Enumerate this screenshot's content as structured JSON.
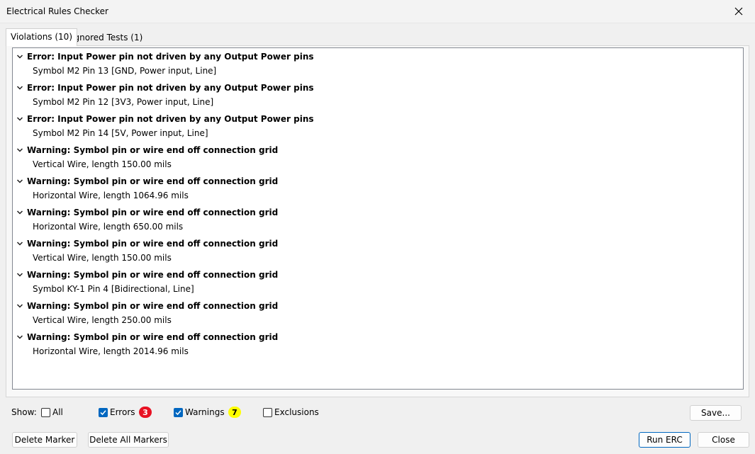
{
  "window": {
    "title": "Electrical Rules Checker"
  },
  "tabs": [
    {
      "label": "Violations (10)"
    },
    {
      "label": "Ignored Tests (1)"
    }
  ],
  "violations": [
    {
      "title": "Error: Input Power pin not driven by any Output Power pins",
      "detail": "Symbol M2 Pin 13 [GND, Power input, Line]"
    },
    {
      "title": "Error: Input Power pin not driven by any Output Power pins",
      "detail": "Symbol M2 Pin 12 [3V3, Power input, Line]"
    },
    {
      "title": "Error: Input Power pin not driven by any Output Power pins",
      "detail": "Symbol M2 Pin 14 [5V, Power input, Line]"
    },
    {
      "title": "Warning: Symbol pin or wire end off connection grid",
      "detail": "Vertical Wire, length 150.00 mils"
    },
    {
      "title": "Warning: Symbol pin or wire end off connection grid",
      "detail": "Horizontal Wire, length 1064.96 mils"
    },
    {
      "title": "Warning: Symbol pin or wire end off connection grid",
      "detail": "Horizontal Wire, length 650.00 mils"
    },
    {
      "title": "Warning: Symbol pin or wire end off connection grid",
      "detail": "Vertical Wire, length 150.00 mils"
    },
    {
      "title": "Warning: Symbol pin or wire end off connection grid",
      "detail": "Symbol KY-1 Pin 4 [Bidirectional, Line]"
    },
    {
      "title": "Warning: Symbol pin or wire end off connection grid",
      "detail": "Vertical Wire, length 250.00 mils"
    },
    {
      "title": "Warning: Symbol pin or wire end off connection grid",
      "detail": "Horizontal Wire, length 2014.96 mils"
    }
  ],
  "filters": {
    "show_label": "Show:",
    "all": {
      "label": "All",
      "checked": false
    },
    "errors": {
      "label": "Errors",
      "checked": true,
      "count": "3",
      "badge_color": "#e81123"
    },
    "warnings": {
      "label": "Warnings",
      "checked": true,
      "count": "7",
      "badge_color": "#ffff00"
    },
    "exclusions": {
      "label": "Exclusions",
      "checked": false
    }
  },
  "buttons": {
    "save": "Save...",
    "delete_marker": "Delete Marker",
    "delete_all_markers": "Delete All Markers",
    "run_erc": "Run ERC",
    "close": "Close"
  },
  "icons": {
    "close": "close-icon",
    "expand": "chevron-down-icon",
    "check": "checkmark-icon"
  }
}
